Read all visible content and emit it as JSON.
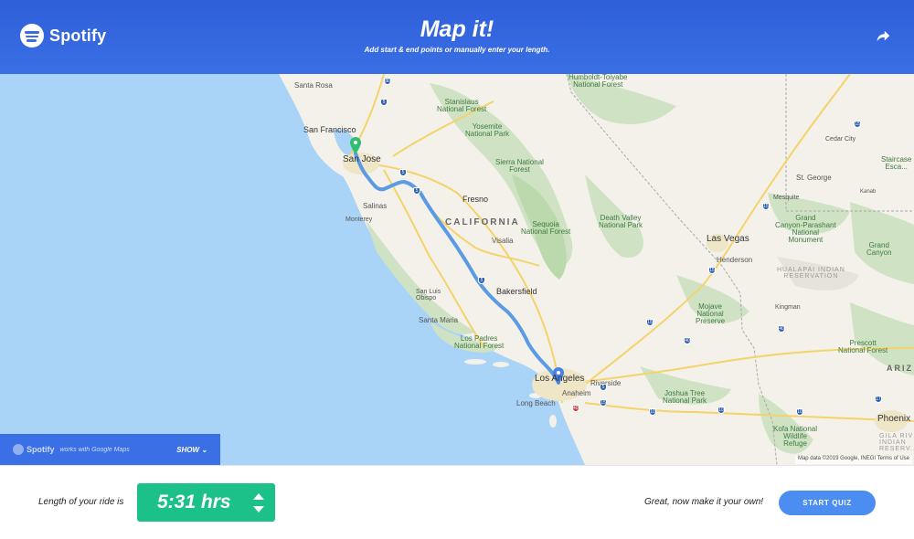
{
  "header": {
    "brand": "Spotify",
    "title": "Map it!",
    "subtitle": "Add start & end points or manually enter your length.",
    "share_icon": "share-arrow-icon"
  },
  "map": {
    "labels": {
      "santa_rosa": "Santa Rosa",
      "san_francisco": "San Francisco",
      "san_jose": "San Jose",
      "stanislaus": "Stanislaus\nNational Forest",
      "yosemite": "Yosemite\nNational Park",
      "sierra": "Sierra National\nForest",
      "humboldt": "Humboldt-Toiyabe\nNational Forest",
      "fresno": "Fresno",
      "california": "CALIFORNIA",
      "salinas": "Salinas",
      "monterey": "Monterey",
      "visalia": "Visalia",
      "sequoia": "Sequoia\nNational Forest",
      "death_valley": "Death Valley\nNational Park",
      "bakersfield": "Bakersfield",
      "san_luis": "San Luis\nObispo",
      "santa_maria": "Santa Maria",
      "los_padres": "Los Padres\nNational Forest",
      "los_angeles": "Los Angeles",
      "riverside": "Riverside",
      "anaheim": "Anaheim",
      "long_beach": "Long Beach",
      "joshua_tree": "Joshua Tree\nNational Park",
      "mojave": "Mojave\nNational\nPreserve",
      "las_vegas": "Las Vegas",
      "henderson": "Henderson",
      "hualapai": "HUALAPAI INDIAN\nRESERVATION",
      "kingman": "Kingman",
      "grand_canyon": "Grand\nCanyon-Parashant\nNational\nMonument",
      "cedar_city": "Cedar City",
      "st_george": "St. George",
      "kanab": "Kanab",
      "mesquite": "Mesquite",
      "grand_canyon_right": "Grand\nCanyon",
      "staircase": "Staircase\nEsca...",
      "kofa": "Kofa National\nWildlife\nRefuge",
      "prescott": "Prescott\nNational Forest",
      "phoenix": "Phoenix",
      "gila": "GILA RIV\nINDIAN\nRESERV...",
      "ariz": "ARIZ"
    },
    "shields": [
      "5",
      "80",
      "5",
      "5",
      "15",
      "15",
      "40",
      "10",
      "10",
      "15",
      "15",
      "40",
      "5",
      "405",
      "15",
      "5",
      "17",
      "10"
    ],
    "badge": {
      "brand": "Spotify",
      "works": "works with Google Maps",
      "show": "SHOW"
    },
    "credit": "Map data ©2019 Google, INEGI   Terms of Use"
  },
  "footer": {
    "ride_label": "Length of your ride is",
    "ride_value": "5:31 hrs",
    "cta_text": "Great, now make it your own!",
    "quiz_button": "START QUIZ"
  },
  "colors": {
    "header_blue": "#3a6fe6",
    "ride_green": "#1cc18a",
    "quiz_blue": "#4c8df2",
    "route": "#5b9be6",
    "water": "#a9d3f7"
  }
}
